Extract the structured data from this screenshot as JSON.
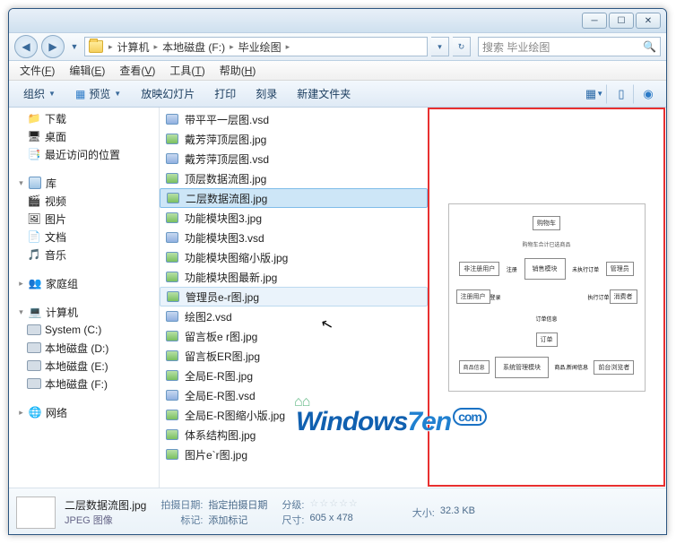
{
  "titlebar": {
    "min": "─",
    "max": "☐",
    "close": "✕"
  },
  "address": {
    "crumbs": [
      "计算机",
      "本地磁盘 (F:)",
      "毕业绘图"
    ],
    "search_placeholder": "搜索 毕业绘图"
  },
  "menubar": [
    {
      "l": "文件",
      "k": "F"
    },
    {
      "l": "编辑",
      "k": "E"
    },
    {
      "l": "查看",
      "k": "V"
    },
    {
      "l": "工具",
      "k": "T"
    },
    {
      "l": "帮助",
      "k": "H"
    }
  ],
  "toolbar": {
    "organize": "组织",
    "preview": "预览",
    "slideshow": "放映幻灯片",
    "print": "打印",
    "burn": "刻录",
    "newfolder": "新建文件夹"
  },
  "nav": {
    "items": [
      {
        "kind": "child",
        "label": "下载",
        "icon": "folder"
      },
      {
        "kind": "child",
        "label": "桌面",
        "icon": "desktop"
      },
      {
        "kind": "child",
        "label": "最近访问的位置",
        "icon": "recent"
      },
      {
        "kind": "spacer"
      },
      {
        "kind": "group",
        "label": "库",
        "icon": "library",
        "exp": "▾"
      },
      {
        "kind": "child",
        "label": "视频",
        "icon": "video"
      },
      {
        "kind": "child",
        "label": "图片",
        "icon": "pictures"
      },
      {
        "kind": "child",
        "label": "文档",
        "icon": "docs"
      },
      {
        "kind": "child",
        "label": "音乐",
        "icon": "music"
      },
      {
        "kind": "spacer"
      },
      {
        "kind": "group",
        "label": "家庭组",
        "icon": "homegroup",
        "exp": "▸"
      },
      {
        "kind": "spacer"
      },
      {
        "kind": "group",
        "label": "计算机",
        "icon": "computer",
        "exp": "▾"
      },
      {
        "kind": "child",
        "label": "System (C:)",
        "icon": "drive"
      },
      {
        "kind": "child",
        "label": "本地磁盘 (D:)",
        "icon": "drive"
      },
      {
        "kind": "child",
        "label": "本地磁盘 (E:)",
        "icon": "drive"
      },
      {
        "kind": "child",
        "label": "本地磁盘 (F:)",
        "icon": "drive"
      },
      {
        "kind": "spacer"
      },
      {
        "kind": "group",
        "label": "网络",
        "icon": "network",
        "exp": "▸"
      }
    ]
  },
  "files": [
    {
      "name": "带平平一层图.vsd",
      "type": "vsd"
    },
    {
      "name": "戴芳萍顶层图.jpg",
      "type": "img"
    },
    {
      "name": "戴芳萍顶层图.vsd",
      "type": "vsd"
    },
    {
      "name": "顶层数据流图.jpg",
      "type": "img"
    },
    {
      "name": "二层数据流图.jpg",
      "type": "img",
      "selected": true
    },
    {
      "name": "功能模块图3.jpg",
      "type": "img"
    },
    {
      "name": "功能模块图3.vsd",
      "type": "vsd"
    },
    {
      "name": "功能模块图缩小版.jpg",
      "type": "img"
    },
    {
      "name": "功能模块图最新.jpg",
      "type": "img"
    },
    {
      "name": "管理员e-r图.jpg",
      "type": "img",
      "hover": true
    },
    {
      "name": "绘图2.vsd",
      "type": "vsd"
    },
    {
      "name": "留言板e r图.jpg",
      "type": "img"
    },
    {
      "name": "留言板ER图.jpg",
      "type": "img"
    },
    {
      "name": "全局E-R图.jpg",
      "type": "img"
    },
    {
      "name": "全局E-R图.vsd",
      "type": "vsd"
    },
    {
      "name": "全局E-R图缩小版.jpg",
      "type": "img"
    },
    {
      "name": "体系结构图.jpg",
      "type": "img"
    },
    {
      "name": "图片e`r图.jpg",
      "type": "img"
    }
  ],
  "preview_diagram": {
    "top": "购物车",
    "row1": [
      "非注册用户",
      "注册",
      "销售模块",
      "管理员"
    ],
    "row1b": [
      "注册用户",
      "登录",
      "消费者"
    ],
    "mid": "订单信息",
    "mid2": "订单",
    "row2": [
      "商品信息",
      "系统管理模块",
      "前台浏览者"
    ],
    "side": [
      "购物车合计已选商品",
      "未执行订单",
      "执行订单",
      "商品,新闻信息"
    ]
  },
  "details": {
    "filename": "二层数据流图.jpg",
    "filetype": "JPEG 图像",
    "date_label": "拍摄日期:",
    "date_val": "指定拍摄日期",
    "tags_label": "标记:",
    "tags_val": "添加标记",
    "rating_label": "分级:",
    "dim_label": "尺寸:",
    "dim_val": "605 x 478",
    "size_label": "大小:",
    "size_val": "32.3 KB"
  },
  "watermark": {
    "text1": "Windows",
    "text2": "7en",
    "text3": "com"
  }
}
